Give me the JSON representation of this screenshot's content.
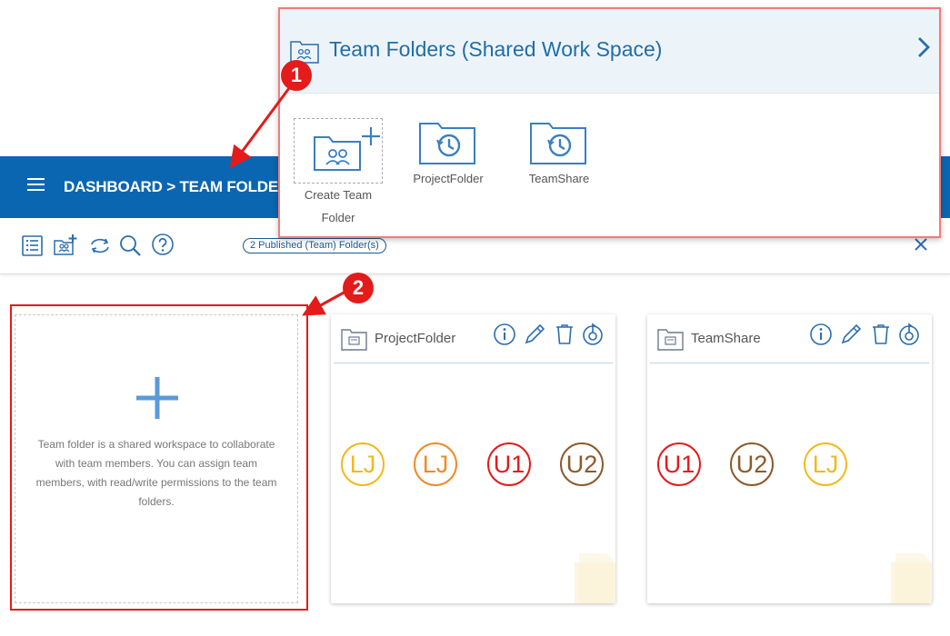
{
  "header": {
    "breadcrumb": "DASHBOARD > TEAM FOLDER"
  },
  "toolbar": {
    "published_pill": "2 Published (Team) Folder(s)"
  },
  "create_card": {
    "description": "Team folder is a shared workspace to collaborate with team members. You can assign team members, with read/write permissions to the team folders."
  },
  "folders": [
    {
      "name": "ProjectFolder",
      "avatars": [
        {
          "initials": "LJ",
          "color": "#f2b81c"
        },
        {
          "initials": "LJ",
          "color": "#f08a24"
        },
        {
          "initials": "U1",
          "color": "#e31b1b"
        },
        {
          "initials": "U2",
          "color": "#8a5a2b"
        }
      ]
    },
    {
      "name": "TeamShare",
      "avatars": [
        {
          "initials": "U1",
          "color": "#e31b1b"
        },
        {
          "initials": "U2",
          "color": "#8a5a2b"
        },
        {
          "initials": "LJ",
          "color": "#f2b81c"
        }
      ]
    }
  ],
  "popup": {
    "title": "Team Folders (Shared Work Space)",
    "tiles": [
      {
        "label_line1": "Create Team",
        "label_line2": "Folder"
      },
      {
        "label": "ProjectFolder"
      },
      {
        "label": "TeamShare"
      }
    ]
  },
  "callouts": {
    "one": "1",
    "two": "2"
  },
  "colors": {
    "brand_blue": "#0b66b2",
    "callout_red": "#e31b1b",
    "icon_blue": "#3a7fc0"
  }
}
